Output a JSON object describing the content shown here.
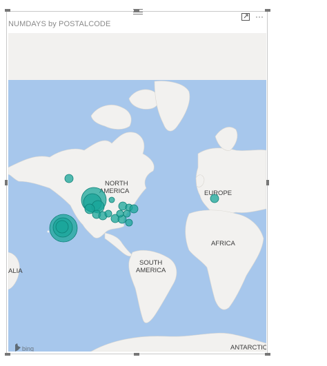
{
  "visual": {
    "title": "NUMDAYS by POSTALCODE",
    "focus_mode_icon": "focus-mode-icon",
    "more_options_icon": "more-options-icon",
    "more_options_label": "···"
  },
  "map": {
    "labels": {
      "north_america_1": "NORTH",
      "north_america_2": "AMERICA",
      "south_america_1": "SOUTH",
      "south_america_2": "AMERICA",
      "europe": "EUROPE",
      "africa": "AFRICA",
      "antarctica": "ANTARCTIC",
      "australia_partial": "ALIA"
    },
    "attribution": "bing",
    "colors": {
      "ocean": "#a7c7ec",
      "land": "#f2f1ef",
      "bubble_fill": "#1aa59a",
      "bubble_stroke": "#0d7f76"
    }
  }
}
